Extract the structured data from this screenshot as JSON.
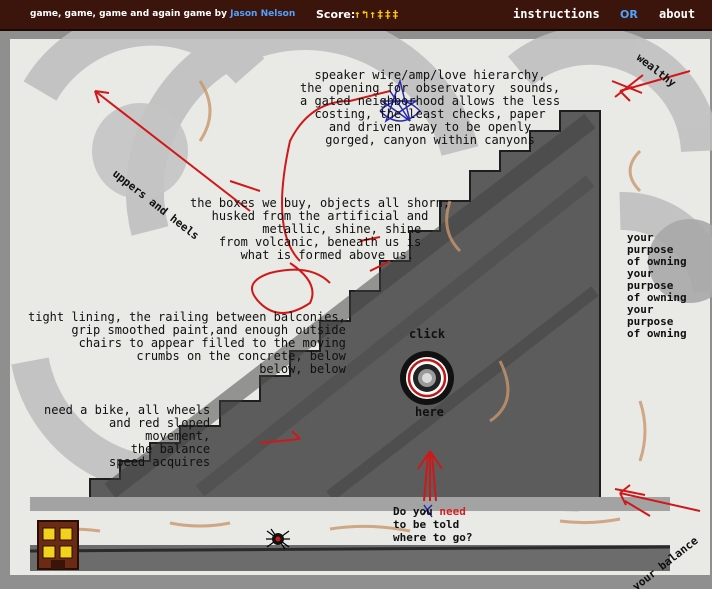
{
  "header": {
    "title": "game, game, game and again game",
    "by": "by",
    "author": "Jason Nelson",
    "score_label": "Score:",
    "score_value": "↑↰↑‡‡‡",
    "instructions_label": "instructions",
    "or_label": "OR",
    "about_label": "about"
  },
  "poems": {
    "speaker": "speaker wire/amp/love hierarchy,\nthe opening for observatory  sounds,\na gated neighborhood allows the less\ncosting, the least checks, paper\nand driven away to be openly\ngorged, canyon within canyons",
    "boxes": "the boxes we buy, objects all shorn,\nhusked from the artificial and\n      metallic, shine, shine\nfrom volcanic, beneath us is\n  what is formed above us.",
    "tight": "tight lining, the railing between balconies,\ngrip smoothed paint,and enough outside\nchairs to appear filled to the moving\ncrumbs on the concrete, below\nbelow, below",
    "bike": "need a bike, all wheels\nand red sloped\nmovement,\nthe balance\nspeed acquires",
    "purpose": "your\npurpose\nof owning\nyour\npurpose\nof owning\nyour\npurpose\nof owning"
  },
  "labels": {
    "uppers": "uppers and heels",
    "wealthy": "wealthy",
    "balance": "your balance",
    "click": "click",
    "here": "here"
  },
  "question": {
    "part1": "Do you ",
    "need": "need",
    "part2": "to be told",
    "part3": "where to go?"
  },
  "icons": {
    "target": "target-button-icon",
    "door": "door-icon",
    "spider": "spider-icon"
  },
  "colors": {
    "header_bg": "#3b140c",
    "score": "#ffcc00",
    "link_blue": "#4fa3ff",
    "scribble_red": "#d01818",
    "highlight_red": "#cc2222"
  }
}
